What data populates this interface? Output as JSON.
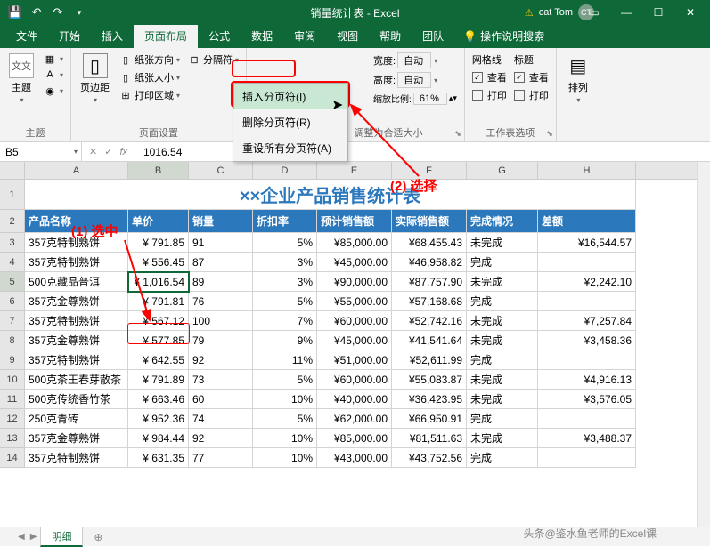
{
  "titlebar": {
    "title": "销量统计表 - Excel",
    "user": "cat Tom",
    "avatar": "CT"
  },
  "tabs": {
    "file": "文件",
    "home": "开始",
    "insert": "插入",
    "layout": "页面布局",
    "formulas": "公式",
    "data": "数据",
    "review": "审阅",
    "view": "视图",
    "help": "帮助",
    "team": "团队",
    "tell": "操作说明搜索"
  },
  "ribbon": {
    "themes_btn": "主题",
    "margins_btn": "页边距",
    "orientation": "纸张方向",
    "size": "纸张大小",
    "print_area": "打印区域",
    "breaks": "分隔符",
    "width": "宽度:",
    "width_val": "自动",
    "height": "高度:",
    "height_val": "自动",
    "scale": "缩放比例:",
    "scale_val": "61%",
    "gridlines": "网格线",
    "headings": "标题",
    "view_chk": "查看",
    "print_chk": "打印",
    "arrange": "排列",
    "group1": "主题",
    "group2": "页面设置",
    "group3": "调整为合适大小",
    "group4": "工作表选项"
  },
  "dropdown": {
    "insert_break": "插入分页符(I)",
    "remove_break": "删除分页符(R)",
    "reset_breaks": "重设所有分页符(A)"
  },
  "formula": {
    "cell_ref": "B5",
    "value": "1016.54"
  },
  "annotations": {
    "step1": "(1) 选中",
    "step2": "(2) 选择"
  },
  "sheet": {
    "title": "××企业产品销售统计表",
    "cols": [
      "A",
      "B",
      "C",
      "D",
      "E",
      "F",
      "G",
      "H"
    ],
    "widths": [
      116,
      68,
      72,
      72,
      84,
      84,
      80,
      110
    ],
    "headers": [
      "产品名称",
      "单价",
      "销量",
      "折扣率",
      "预计销售额",
      "实际销售额",
      "完成情况",
      "差额"
    ],
    "rows": [
      {
        "n": 3,
        "d": [
          "357克特制熟饼",
          "¥   791.85",
          "91",
          "5%",
          "¥85,000.00",
          "¥68,455.43",
          "未完成",
          "¥16,544.57"
        ]
      },
      {
        "n": 4,
        "d": [
          "357克特制熟饼",
          "¥   556.45",
          "87",
          "3%",
          "¥45,000.00",
          "¥46,958.82",
          "完成",
          ""
        ]
      },
      {
        "n": 5,
        "d": [
          "500克藏品普洱",
          "¥ 1,016.54",
          "89",
          "3%",
          "¥90,000.00",
          "¥87,757.90",
          "未完成",
          "¥2,242.10"
        ]
      },
      {
        "n": 6,
        "d": [
          "357克金尊熟饼",
          "¥   791.81",
          "76",
          "5%",
          "¥55,000.00",
          "¥57,168.68",
          "完成",
          ""
        ]
      },
      {
        "n": 7,
        "d": [
          "357克特制熟饼",
          "¥   567.12",
          "100",
          "7%",
          "¥60,000.00",
          "¥52,742.16",
          "未完成",
          "¥7,257.84"
        ]
      },
      {
        "n": 8,
        "d": [
          "357克金尊熟饼",
          "¥   577.85",
          "79",
          "9%",
          "¥45,000.00",
          "¥41,541.64",
          "未完成",
          "¥3,458.36"
        ]
      },
      {
        "n": 9,
        "d": [
          "357克特制熟饼",
          "¥   642.55",
          "92",
          "11%",
          "¥51,000.00",
          "¥52,611.99",
          "完成",
          ""
        ]
      },
      {
        "n": 10,
        "d": [
          "500克茶王春芽散茶",
          "¥   791.89",
          "73",
          "5%",
          "¥60,000.00",
          "¥55,083.87",
          "未完成",
          "¥4,916.13"
        ]
      },
      {
        "n": 11,
        "d": [
          "500克传统香竹茶",
          "¥   663.46",
          "60",
          "10%",
          "¥40,000.00",
          "¥36,423.95",
          "未完成",
          "¥3,576.05"
        ]
      },
      {
        "n": 12,
        "d": [
          "250克青砖",
          "¥   952.36",
          "74",
          "5%",
          "¥62,000.00",
          "¥66,950.91",
          "完成",
          ""
        ]
      },
      {
        "n": 13,
        "d": [
          "357克金尊熟饼",
          "¥   984.44",
          "92",
          "10%",
          "¥85,000.00",
          "¥81,511.63",
          "未完成",
          "¥3,488.37"
        ]
      },
      {
        "n": 14,
        "d": [
          "357克特制熟饼",
          "¥   631.35",
          "77",
          "10%",
          "¥43,000.00",
          "¥43,752.56",
          "完成",
          ""
        ]
      }
    ],
    "tab": "明细"
  },
  "watermark": "头条@鉴水鱼老师的Excel课"
}
